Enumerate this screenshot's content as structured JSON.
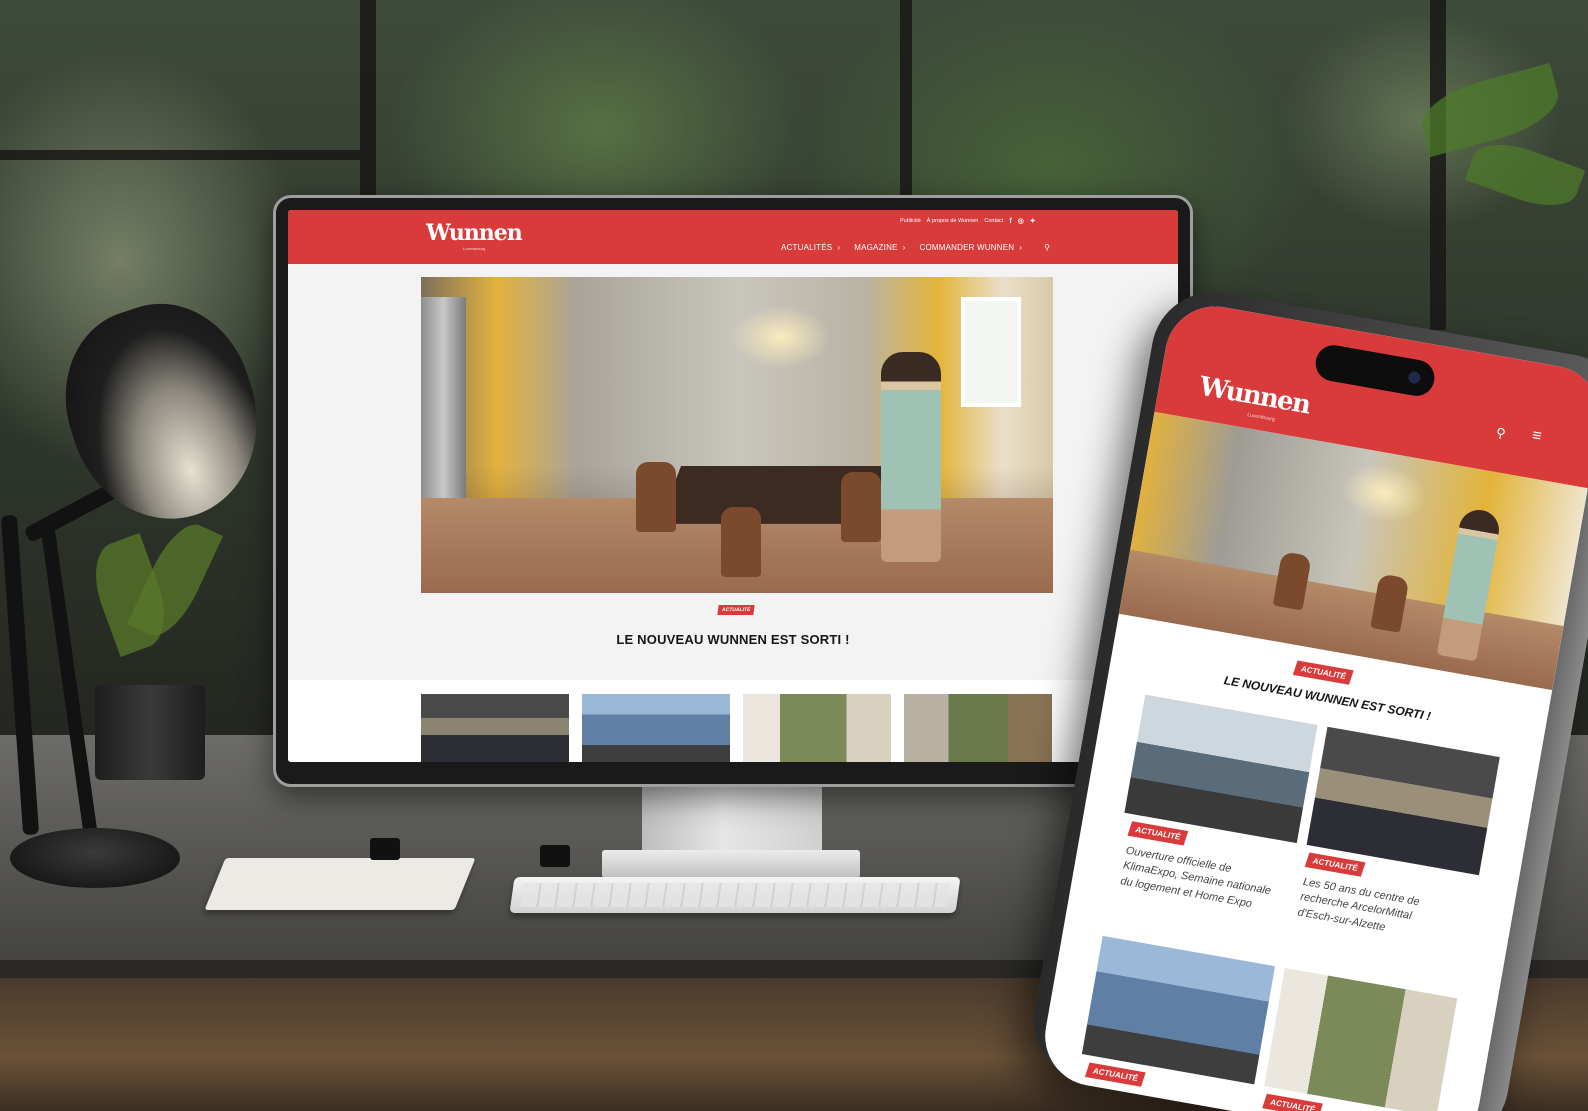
{
  "colors": {
    "brand_red": "#d93b3b",
    "page_bg": "#f3f3f3",
    "headline": "#161616"
  },
  "desktop": {
    "logo": "Wunnen",
    "logo_sub": "Luxembourg",
    "top_links": [
      "Publicité",
      "À propos de Wunnen",
      "Contact"
    ],
    "social_icons": [
      "facebook-icon",
      "instagram-icon",
      "twitter-icon"
    ],
    "nav": [
      {
        "label": "ACTUALITÉS"
      },
      {
        "label": "MAGAZINE"
      },
      {
        "label": "COMMANDER WUNNEN"
      }
    ],
    "search_icon": "search-icon",
    "hero_badge": "ACTUALITÉ",
    "hero_headline": "LE NOUVEAU WUNNEN EST SORTI !"
  },
  "mobile": {
    "logo": "Wunnen",
    "logo_sub": "Luxembourg",
    "search_icon": "search-icon",
    "menu_icon": "hamburger-menu-icon",
    "hero_badge": "ACTUALITÉ",
    "hero_headline": "LE NOUVEAU WUNNEN EST SORTI !",
    "cards": [
      {
        "badge": "ACTUALITÉ",
        "title": "Ouverture officielle de KlimaExpo, Semaine nationale du logement et Home Expo"
      },
      {
        "badge": "ACTUALITÉ",
        "title": "Les 50 ans du centre de recherche ArcelorMittal d'Esch-sur-Alzette"
      },
      {
        "badge": "ACTUALITÉ",
        "title": ""
      },
      {
        "badge": "ACTUALITÉ",
        "title": ""
      }
    ]
  }
}
